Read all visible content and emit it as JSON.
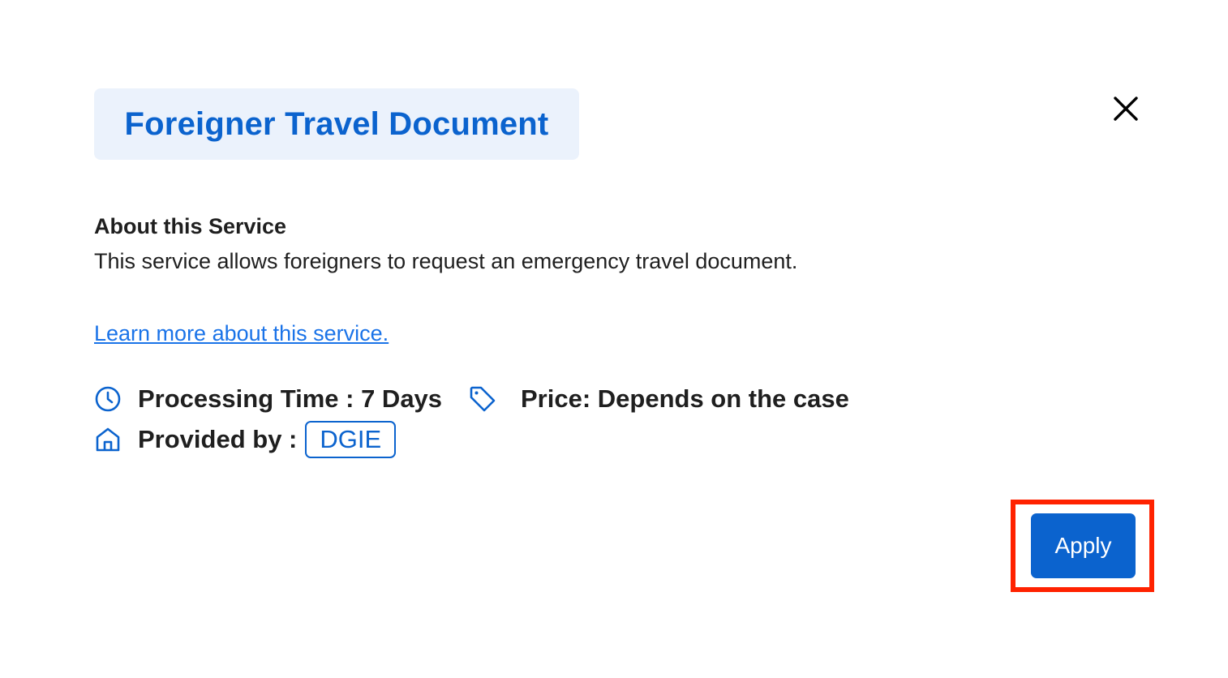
{
  "header": {
    "title": "Foreigner Travel Document",
    "close_icon": "close-icon"
  },
  "about": {
    "heading": "About this Service",
    "description": "This service allows foreigners to request an emergency travel document."
  },
  "link": {
    "label": "Learn more about this service."
  },
  "details": {
    "processing_time": "Processing Time : 7 Days",
    "processing_icon": "clock-icon",
    "price": "Price: Depends on the case",
    "price_icon": "tag-icon",
    "provided_by_label": "Provided by :",
    "provided_by_icon": "home-icon",
    "provider": "DGIE"
  },
  "actions": {
    "apply_label": "Apply"
  },
  "colors": {
    "primary": "#0b63ce",
    "title_background": "#ebf2fc",
    "link": "#1a73e8",
    "highlight": "#ff2200",
    "text": "#1f1f1f"
  }
}
